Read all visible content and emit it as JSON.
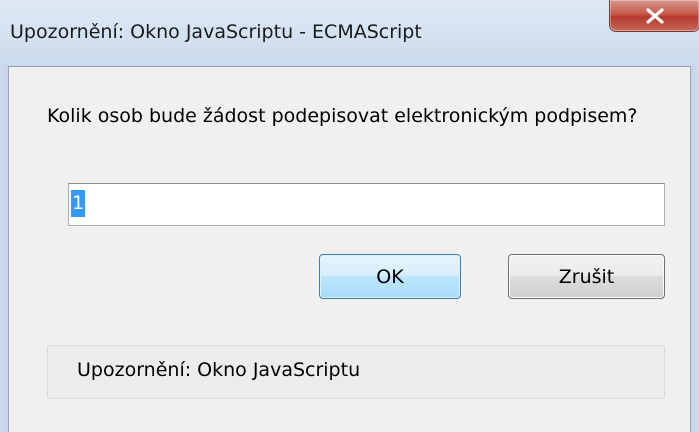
{
  "window": {
    "title": "Upozornění: Okno JavaScriptu - ECMAScript",
    "close_icon": "close-x-icon"
  },
  "dialog": {
    "prompt": "Kolik osob bude žádost podepisovat elektronickým podpisem?",
    "input_value": "1",
    "input_value_selected": true,
    "ok_label": "OK",
    "cancel_label": "Zrušit",
    "status_text": "Upozornění: Okno JavaScriptu"
  },
  "colors": {
    "selection": "#3399ff",
    "close_button": "#c7574a",
    "ok_button_border": "#3c7fb1"
  }
}
